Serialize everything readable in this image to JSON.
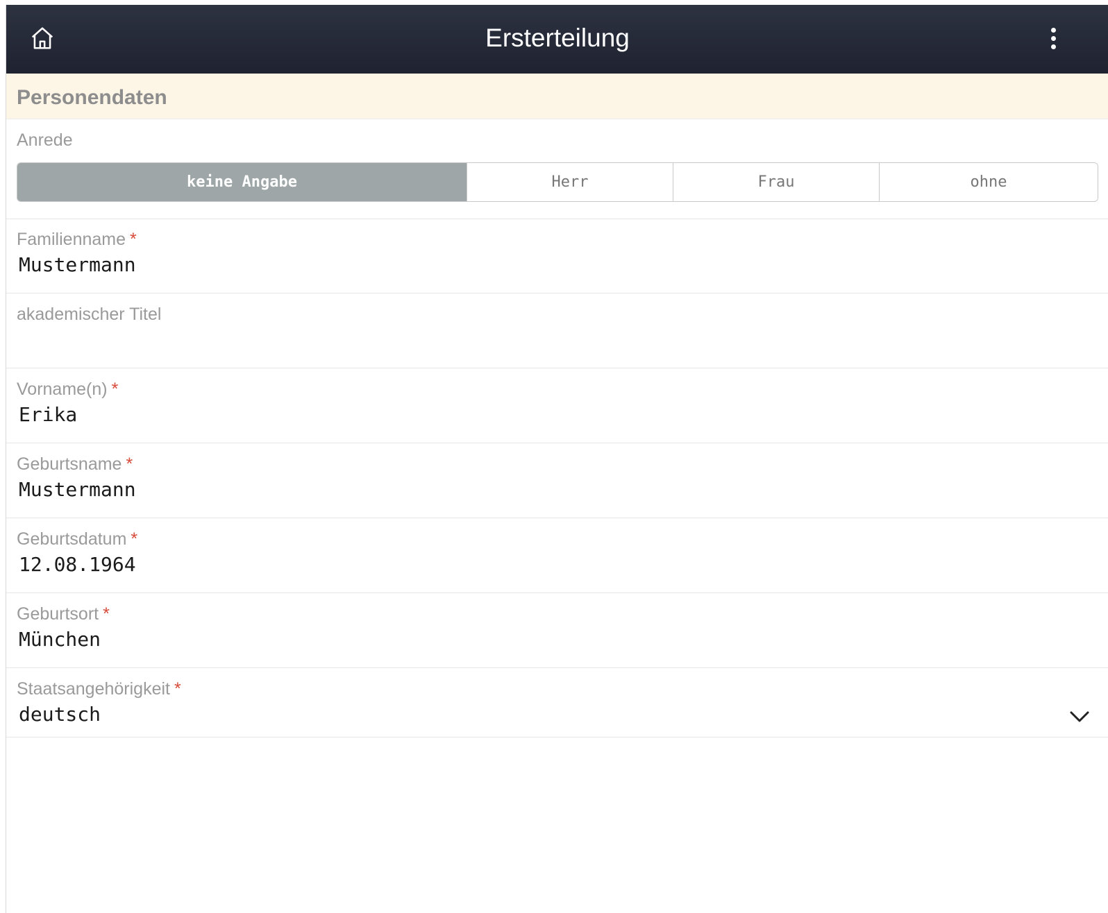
{
  "header": {
    "title": "Ersterteilung",
    "home_icon": "home-icon",
    "menu_icon": "more-vertical-icon",
    "background": "#252a37"
  },
  "section": {
    "title": "Personendaten",
    "background": "#fdf5e6"
  },
  "anrede": {
    "label": "Anrede",
    "options": [
      "keine Angabe",
      "Herr",
      "Frau",
      "ohne"
    ],
    "selected": "keine Angabe"
  },
  "fields": {
    "familienname": {
      "label": "Familienname",
      "required": "*",
      "value": "Mustermann"
    },
    "titel": {
      "label": "akademischer Titel",
      "value": ""
    },
    "vorname": {
      "label": "Vorname(n)",
      "required": "*",
      "value": "Erika"
    },
    "geburtsname": {
      "label": "Geburtsname",
      "required": "*",
      "value": "Mustermann"
    },
    "geburtsdatum": {
      "label": "Geburtsdatum",
      "required": "*",
      "value": "12.08.1964"
    },
    "geburtsort": {
      "label": "Geburtsort",
      "required": "*",
      "value": "München"
    },
    "staatsangehoerigkeit": {
      "label": "Staatsangehörigkeit",
      "required": "*",
      "value": "deutsch",
      "icon": "chevron-down-icon"
    }
  },
  "colors": {
    "required": "#d84a3a",
    "active_segment": "#9ea6a8"
  }
}
